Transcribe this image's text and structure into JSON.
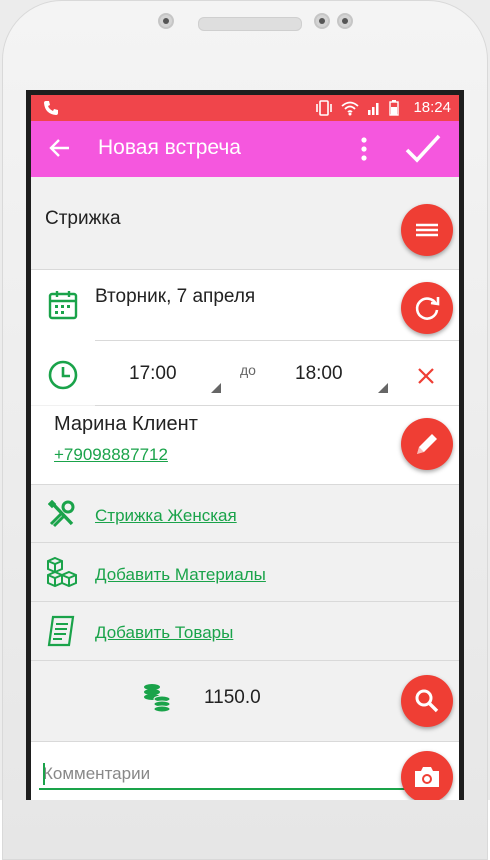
{
  "status_bar": {
    "time": "18:24"
  },
  "app_bar": {
    "title": "Новая встреча"
  },
  "appointment": {
    "service": "Стрижка",
    "date": "Вторник, 7 апреля",
    "time_from": "17:00",
    "time_to_label": "до",
    "time_to": "18:00"
  },
  "client": {
    "name": "Марина Клиент",
    "phone": "+79098887712"
  },
  "links": {
    "service": "Стрижка Женская",
    "materials": "Добавить Материалы",
    "goods": "Добавить Товары"
  },
  "price": "1150.0",
  "comment": {
    "placeholder": "Комментарии",
    "value": ""
  },
  "colors": {
    "status_bar": "#f0454b",
    "app_bar": "#f557de",
    "fab": "#ef3e34",
    "green": "#1aa34a"
  }
}
